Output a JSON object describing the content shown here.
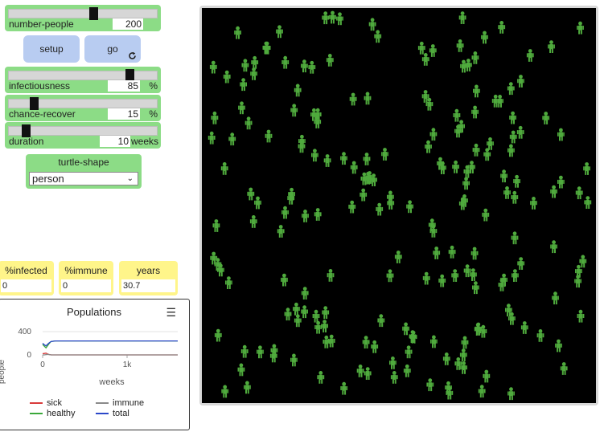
{
  "sliders": {
    "number_people": {
      "label": "number-people",
      "value": "200",
      "unit": "",
      "fraction": 0.58
    },
    "infectiousness": {
      "label": "infectiousness",
      "value": "85",
      "unit": "%",
      "fraction": 0.84
    },
    "chance_recover": {
      "label": "chance-recover",
      "value": "15",
      "unit": "%",
      "fraction": 0.15
    },
    "duration": {
      "label": "duration",
      "value": "10",
      "unit": "weeks",
      "fraction": 0.09
    }
  },
  "buttons": {
    "setup": "setup",
    "go": "go",
    "go_icon": "forever-icon"
  },
  "chooser": {
    "label": "turtle-shape",
    "selected": "person"
  },
  "monitors": [
    {
      "label": "%infected",
      "value": "0"
    },
    {
      "label": "%immune",
      "value": "0"
    },
    {
      "label": "years",
      "value": "30.7"
    }
  ],
  "plot": {
    "title": "Populations",
    "ylabel": "people",
    "xlabel": "weeks",
    "yticks": [
      "400",
      "0"
    ],
    "xticks": [
      "0",
      "1k"
    ],
    "legend": [
      {
        "name": "sick",
        "color": "#d93b3b"
      },
      {
        "name": "immune",
        "color": "#8a8a8a"
      },
      {
        "name": "healthy",
        "color": "#3aa83a"
      },
      {
        "name": "total",
        "color": "#2b48c9"
      }
    ]
  },
  "chart_data": {
    "type": "line",
    "title": "Populations",
    "xlabel": "weeks",
    "ylabel": "people",
    "xlim": [
      0,
      1600
    ],
    "ylim": [
      0,
      400
    ],
    "x": [
      0,
      20,
      40,
      60,
      80,
      100,
      150,
      200,
      400,
      800,
      1200,
      1600
    ],
    "series": [
      {
        "name": "sick",
        "color": "#d93b3b",
        "values": [
          20,
          25,
          30,
          15,
          5,
          1,
          0,
          0,
          0,
          0,
          0,
          0
        ]
      },
      {
        "name": "immune",
        "color": "#8a8a8a",
        "values": [
          0,
          0,
          5,
          10,
          5,
          0,
          0,
          0,
          0,
          0,
          0,
          0
        ]
      },
      {
        "name": "healthy",
        "color": "#3aa83a",
        "values": [
          180,
          150,
          120,
          160,
          200,
          230,
          240,
          240,
          240,
          240,
          240,
          240
        ]
      },
      {
        "name": "total",
        "color": "#2b48c9",
        "values": [
          200,
          175,
          155,
          185,
          210,
          230,
          240,
          240,
          240,
          240,
          240,
          240
        ]
      }
    ]
  },
  "view": {
    "background": "#000000",
    "turtle_color": "#4faa3d",
    "turtle_count": 200
  }
}
